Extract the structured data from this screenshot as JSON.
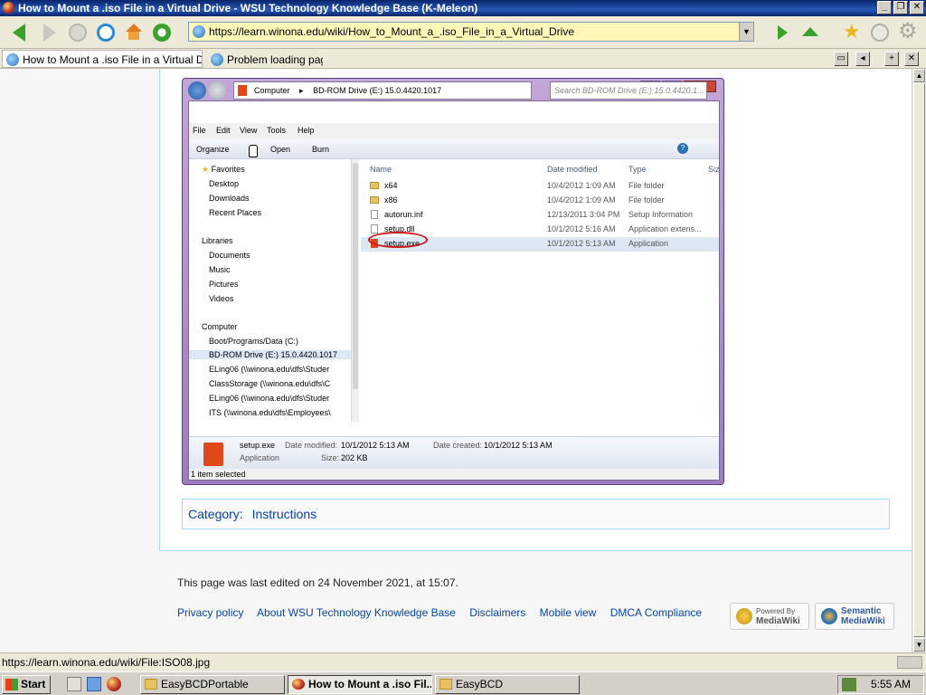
{
  "window": {
    "title": "How to Mount a .iso File in a Virtual Drive - WSU Technology Knowledge Base (K-Meleon)"
  },
  "toolbar": {
    "url": "https://learn.winona.edu/wiki/How_to_Mount_a_.iso_File_in_a_Virtual_Drive"
  },
  "tabs": [
    {
      "label": "How to Mount a .iso File in a Virtual Dri..."
    },
    {
      "label": "Problem loading page"
    }
  ],
  "explorer": {
    "path": [
      "Computer",
      "BD-ROM Drive (E:) 15.0.4420.1017"
    ],
    "search_placeholder": "Search BD-ROM Drive (E:) 15.0.4420.1...",
    "menu": [
      "File",
      "Edit",
      "View",
      "Tools",
      "Help"
    ],
    "commands": [
      "Organize",
      "Open",
      "Burn"
    ],
    "nav": {
      "favorites_header": "Favorites",
      "favorites": [
        "Desktop",
        "Downloads",
        "Recent Places"
      ],
      "libraries_header": "Libraries",
      "libraries": [
        "Documents",
        "Music",
        "Pictures",
        "Videos"
      ],
      "computer_header": "Computer",
      "computer": [
        "Boot/Programs/Data (C:)",
        "BD-ROM Drive (E:) 15.0.4420.1017",
        "ELing06 (\\\\winona.edu\\dfs\\Studer",
        "ClassStorage (\\\\winona.edu\\dfs\\C",
        "ELing06 (\\\\winona.edu\\dfs\\Studer",
        "ITS (\\\\winona.edu\\dfs\\Employees\\"
      ]
    },
    "columns": [
      "Name",
      "Date modified",
      "Type",
      "Siz"
    ],
    "files": [
      {
        "name": "x64",
        "date": "10/4/2012 1:09 AM",
        "type": "File folder",
        "icon": "folder-icon"
      },
      {
        "name": "x86",
        "date": "10/4/2012 1:09 AM",
        "type": "File folder",
        "icon": "folder-icon"
      },
      {
        "name": "autorun.inf",
        "date": "12/13/2011 3:04 PM",
        "type": "Setup Information",
        "icon": "file-icon"
      },
      {
        "name": "setup.dll",
        "date": "10/1/2012 5:16 AM",
        "type": "Application extens...",
        "icon": "file-icon"
      },
      {
        "name": "setup.exe",
        "date": "10/1/2012 5:13 AM",
        "type": "Application",
        "icon": "office-icon"
      }
    ],
    "details": {
      "name": "setup.exe",
      "type": "Application",
      "modified_label": "Date modified:",
      "modified": "10/1/2012 5:13 AM",
      "created_label": "Date created:",
      "created": "10/1/2012 5:13 AM",
      "size_label": "Size:",
      "size": "202 KB"
    },
    "status": "1 item selected"
  },
  "category": {
    "label": "Category:",
    "value": "Instructions"
  },
  "footer": {
    "last_edited": "This page was last edited on 24 November 2021, at 15:07.",
    "links": [
      "Privacy policy",
      "About WSU Technology Knowledge Base",
      "Disclaimers",
      "Mobile view",
      "DMCA Compliance"
    ],
    "badge_mediawiki": [
      "Powered By",
      "MediaWiki"
    ],
    "badge_semantic": [
      "Semantic",
      "MediaWiki"
    ]
  },
  "statusbar": {
    "text": "https://learn.winona.edu/wiki/File:ISO08.jpg"
  },
  "taskbar": {
    "start": "Start",
    "tasks": [
      "EasyBCDPortable",
      "How to Mount a .iso Fil...",
      "EasyBCD"
    ],
    "clock": "5:55 AM"
  }
}
